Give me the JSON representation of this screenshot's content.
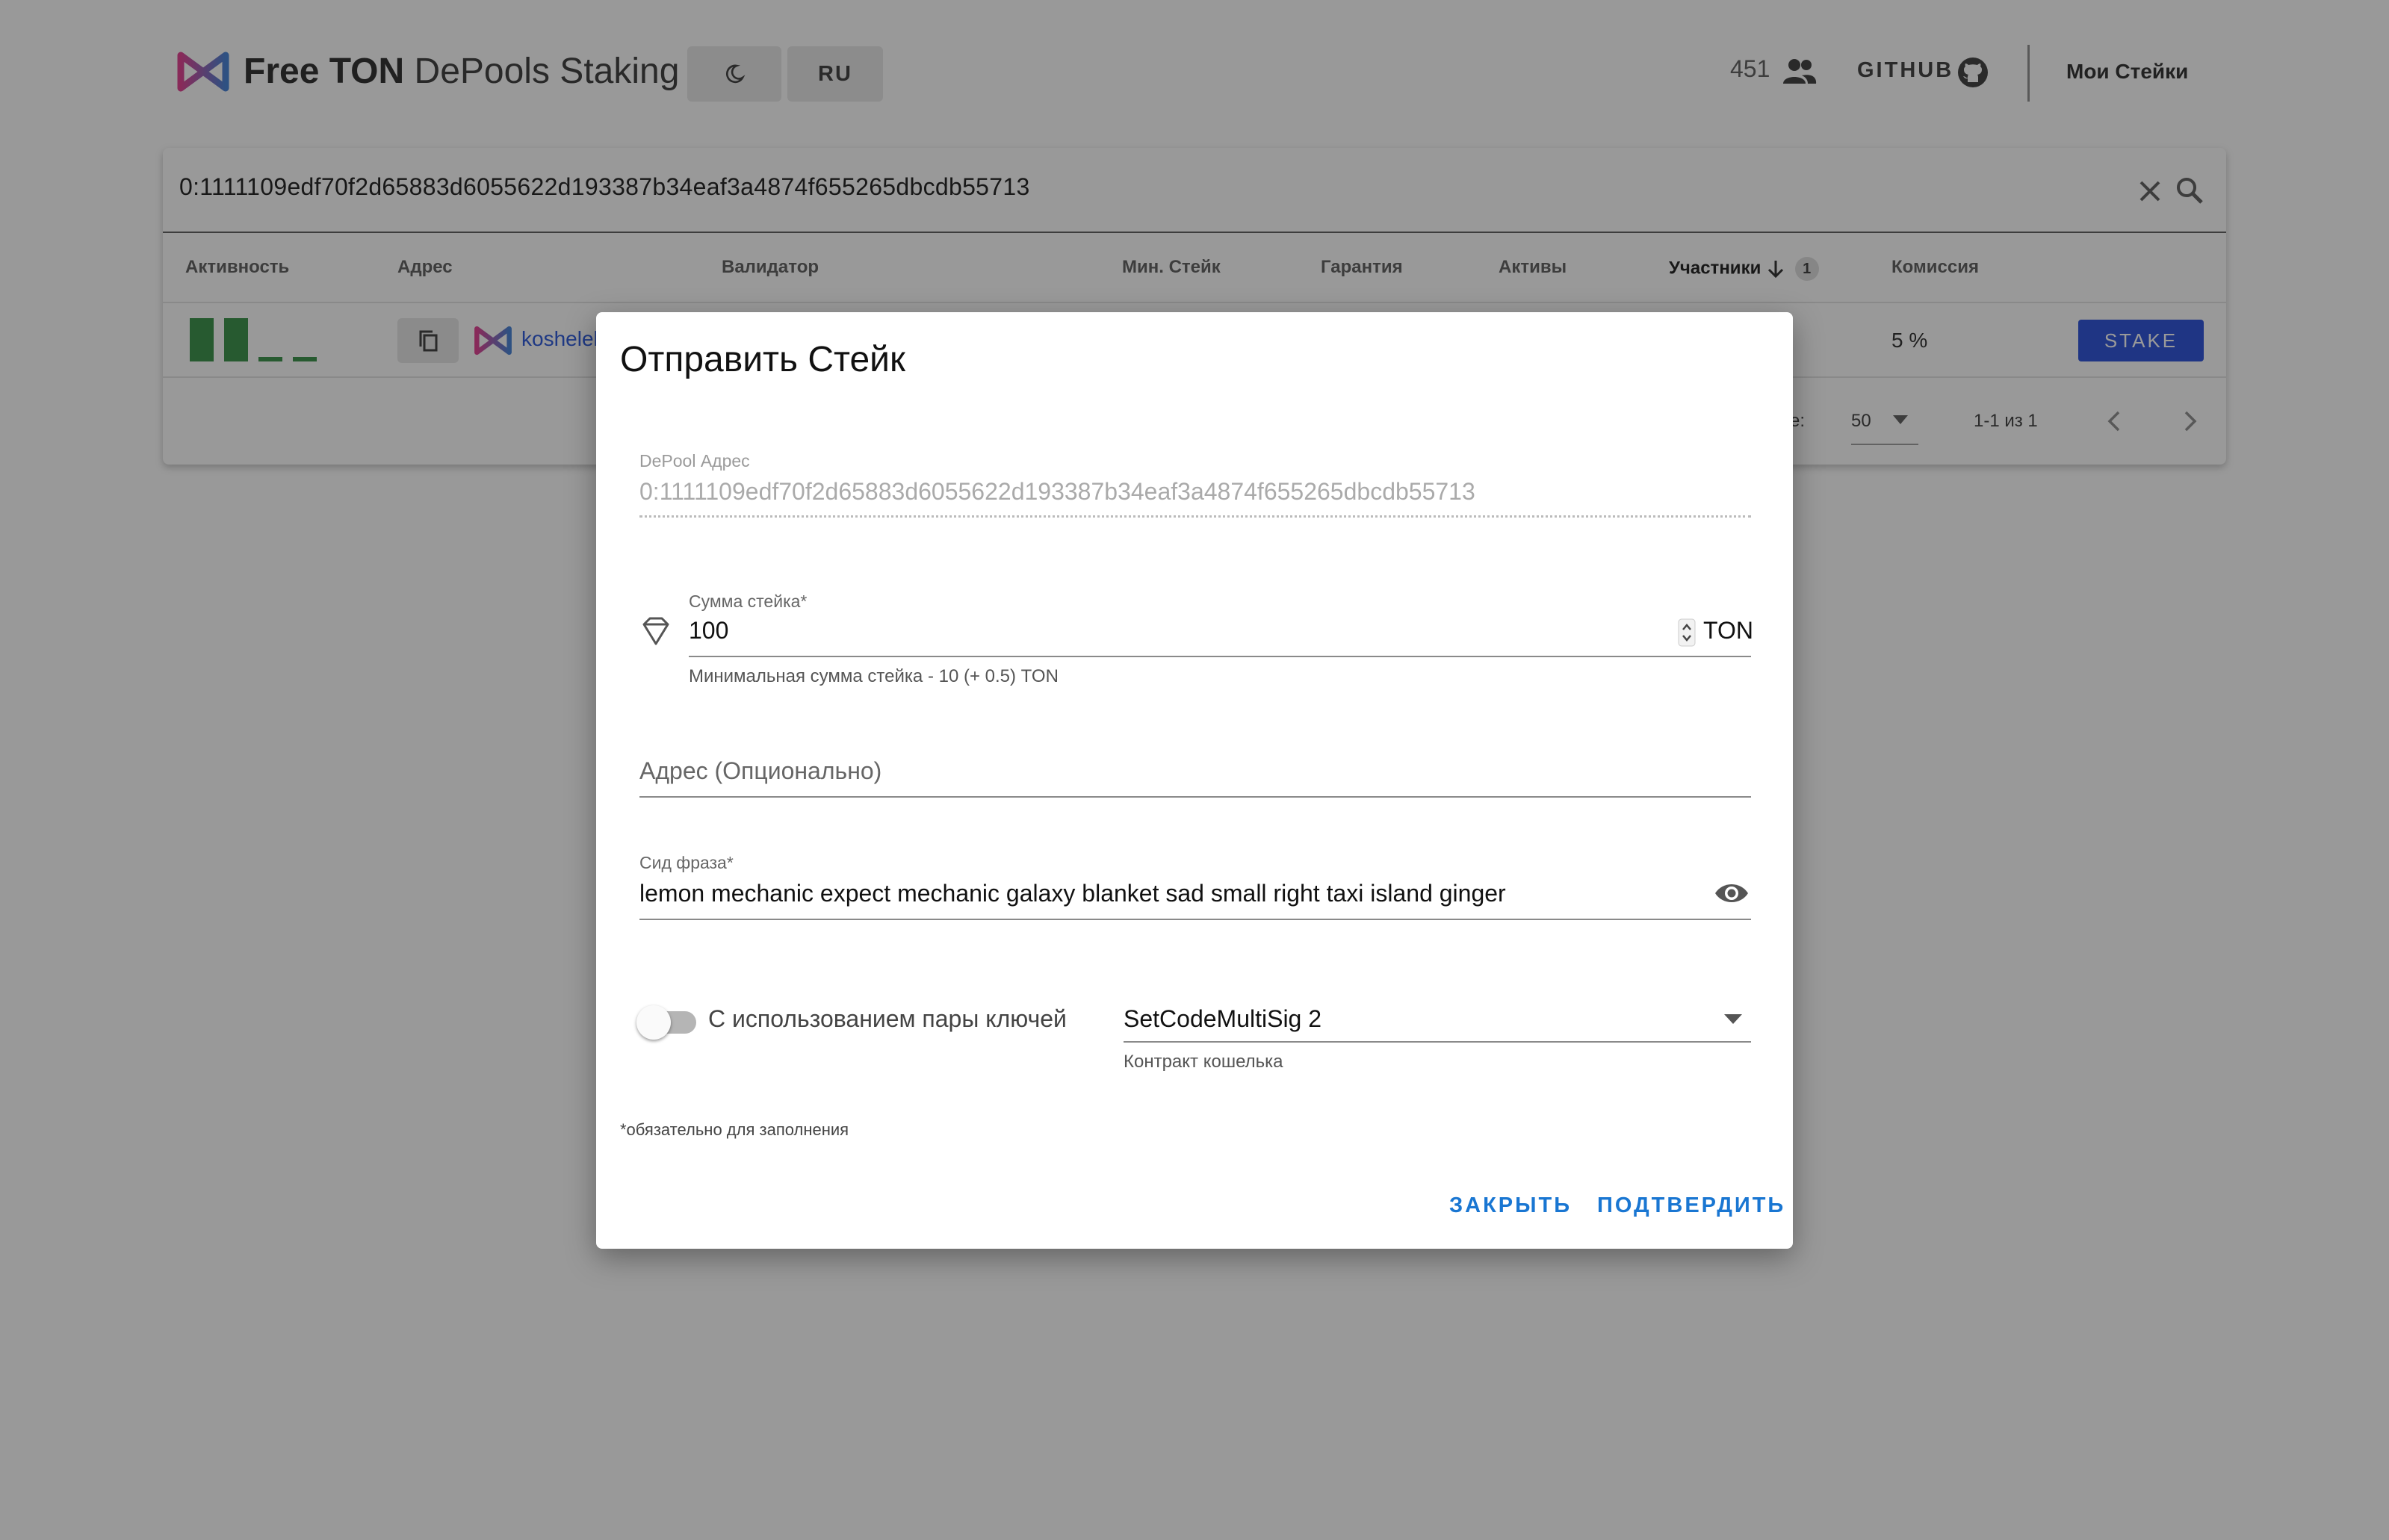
{
  "header": {
    "brand_bold": "Free TON",
    "brand_rest": "DePools Staking",
    "lang_button": "RU",
    "users_count": "451",
    "github_label": "GITHUB",
    "my_stakes": "Мои Стейки"
  },
  "search": {
    "value": "0:1111109edf70f2d65883d6055622d193387b34eaf3a4874f655265dbcdb55713"
  },
  "table": {
    "columns": [
      "Активность",
      "Адрес",
      "Валидатор",
      "Мин. Стейк",
      "Гарантия",
      "Активы",
      "Участники",
      "Комиссия"
    ],
    "sort_count": "1",
    "row": {
      "activity_bars": [
        1.0,
        1.0,
        0.12,
        0.12
      ],
      "address": "koshelek",
      "commission": "5 %",
      "action": "STAKE"
    },
    "pagination": {
      "rows_per_page_label_tail": "e:",
      "rows_per_page": "50",
      "range": "1-1 из 1"
    }
  },
  "dialog": {
    "title": "Отправить Стейк",
    "depool": {
      "label": "DePool Адрес",
      "value": "0:1111109edf70f2d65883d6055622d193387b34eaf3a4874f655265dbcdb55713"
    },
    "amount": {
      "label": "Сумма стейка*",
      "value": "100",
      "suffix": "TON",
      "hint": "Минимальная сумма стейка - 10 (+ 0.5) TON"
    },
    "address": {
      "placeholder": "Адрес (Опционально)"
    },
    "seed": {
      "label": "Сид фраза*",
      "value": "lemon mechanic expect mechanic galaxy blanket sad small right taxi island ginger"
    },
    "keypair_switch": {
      "label": "С использованием пары ключей",
      "on": false
    },
    "wallet_contract": {
      "value": "SetCodeMultiSig 2",
      "hint": "Контракт кошелька"
    },
    "required_note": "*обязательно для заполнения",
    "close_label": "ЗАКРЫТЬ",
    "confirm_label": "ПОДТВЕРДИТЬ"
  },
  "colors": {
    "accent": "#1976d2",
    "stake_button": "#1f47d8",
    "activity_bar": "#2e8b3e",
    "overlay": "rgba(33,33,33,0.46)"
  },
  "icons": [
    "free-ton-logo",
    "moon-icon",
    "people-icon",
    "github-icon",
    "close-icon",
    "search-icon",
    "arrow-down-icon",
    "copy-icon",
    "gem-icon",
    "spinner-arrows-icon",
    "eye-icon",
    "chevron-left-icon",
    "chevron-right-icon"
  ]
}
